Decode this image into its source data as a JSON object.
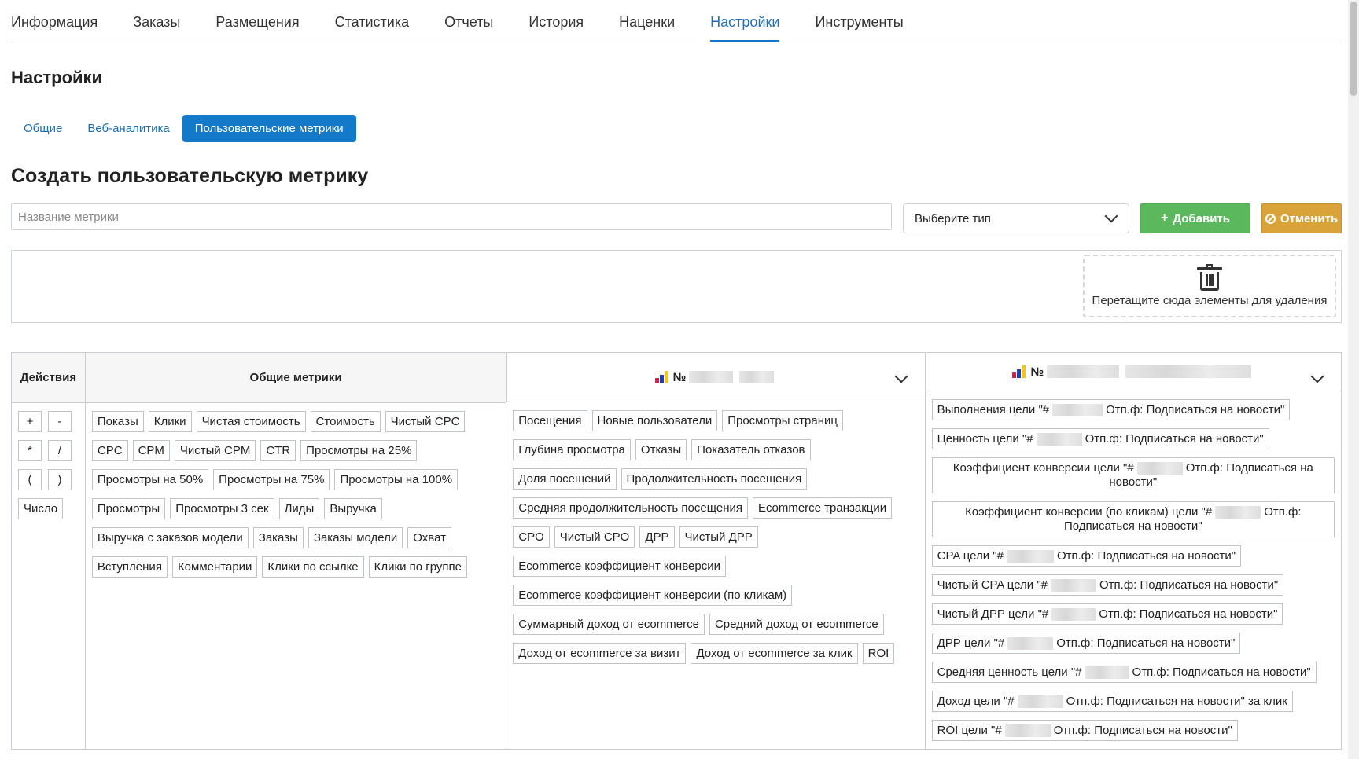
{
  "topnav": [
    {
      "label": "Информация",
      "active": false
    },
    {
      "label": "Заказы",
      "active": false
    },
    {
      "label": "Размещения",
      "active": false
    },
    {
      "label": "Статистика",
      "active": false
    },
    {
      "label": "Отчеты",
      "active": false
    },
    {
      "label": "История",
      "active": false
    },
    {
      "label": "Наценки",
      "active": false
    },
    {
      "label": "Настройки",
      "active": true
    },
    {
      "label": "Инструменты",
      "active": false
    }
  ],
  "page_title": "Настройки",
  "subtabs": [
    {
      "label": "Общие",
      "active": false
    },
    {
      "label": "Веб-аналитика",
      "active": false
    },
    {
      "label": "Пользовательские метрики",
      "active": true
    }
  ],
  "section_title": "Создать пользовательскую метрику",
  "form": {
    "name_placeholder": "Название метрики",
    "type_select_value": "Выберите тип",
    "add_label": "Добавить",
    "cancel_label": "Отменить"
  },
  "dropzone_label": "Перетащите сюда элементы для удаления",
  "colors": {
    "accent": "#1479c9",
    "add": "#5cb85c",
    "cancel": "#d9a33a",
    "counter_icon": [
      "#e6194b",
      "#1a3fbf",
      "#f5c518"
    ]
  },
  "columns": {
    "actions": {
      "title": "Действия",
      "items": [
        "+",
        "-",
        "*",
        "/",
        "(",
        ")",
        "Число"
      ]
    },
    "common": {
      "title": "Общие метрики",
      "items": [
        "Показы",
        "Клики",
        "Чистая стоимость",
        "Стоимость",
        "Чистый CPC",
        "CPC",
        "CPM",
        "Чистый CPM",
        "CTR",
        "Просмотры на 25%",
        "Просмотры на 50%",
        "Просмотры на 75%",
        "Просмотры на 100%",
        "Просмотры",
        "Просмотры 3 сек",
        "Лиды",
        "Выручка",
        "Выручка с заказов модели",
        "Заказы",
        "Заказы модели",
        "Охват",
        "Вступления",
        "Комментарии",
        "Клики по ссылке",
        "Клики по группе"
      ]
    },
    "counter1": {
      "title_prefix": "№",
      "items": [
        "Посещения",
        "Новые пользователи",
        "Просмотры страниц",
        "Глубина просмотра",
        "Отказы",
        "Показатель отказов",
        "Доля посещений",
        "Продолжительность посещения",
        "Средняя продолжительность посещения",
        "Ecommerce транзакции",
        "CPO",
        "Чистый CPO",
        "ДРР",
        "Чистый ДРР",
        "Ecommerce коэффициент конверсии",
        "Ecommerce коэффициент конверсии (по кликам)",
        "Суммарный доход от ecommerce",
        "Средний доход от ecommerce",
        "Доход от ecommerce за визит",
        "Доход от ecommerce за клик",
        "ROI"
      ]
    },
    "counter2": {
      "title_prefix": "№",
      "items": [
        {
          "a": "Выполнения цели \"#",
          "b": "Отп.ф: Подписаться на новости\"",
          "multi": false
        },
        {
          "a": "Ценность цели \"#",
          "b": "Отп.ф: Подписаться на новости\"",
          "multi": false
        },
        {
          "a": "Коэффициент конверсии цели \"#",
          "b": "Отп.ф: Подписаться на новости\"",
          "multi": true
        },
        {
          "a": "Коэффициент конверсии (по кликам) цели \"#",
          "b": "Отп.ф: Подписаться на новости\"",
          "multi": true
        },
        {
          "a": "CPA цели \"#",
          "b": "Отп.ф: Подписаться на новости\"",
          "multi": false
        },
        {
          "a": "Чистый CPA цели \"#",
          "b": "Отп.ф: Подписаться на новости\"",
          "multi": false
        },
        {
          "a": "Чистый ДРР цели \"#",
          "b": "Отп.ф: Подписаться на новости\"",
          "multi": false
        },
        {
          "a": "ДРР цели \"#",
          "b": "Отп.ф: Подписаться на новости\"",
          "multi": false
        },
        {
          "a": "Средняя ценность цели \"#",
          "b": "Отп.ф: Подписаться на новости\"",
          "multi": false
        },
        {
          "a": "Доход цели \"#",
          "b": "Отп.ф: Подписаться на новости\" за клик",
          "multi": false
        },
        {
          "a": "ROI цели \"#",
          "b": "Отп.ф: Подписаться на новости\"",
          "multi": false
        }
      ]
    }
  }
}
